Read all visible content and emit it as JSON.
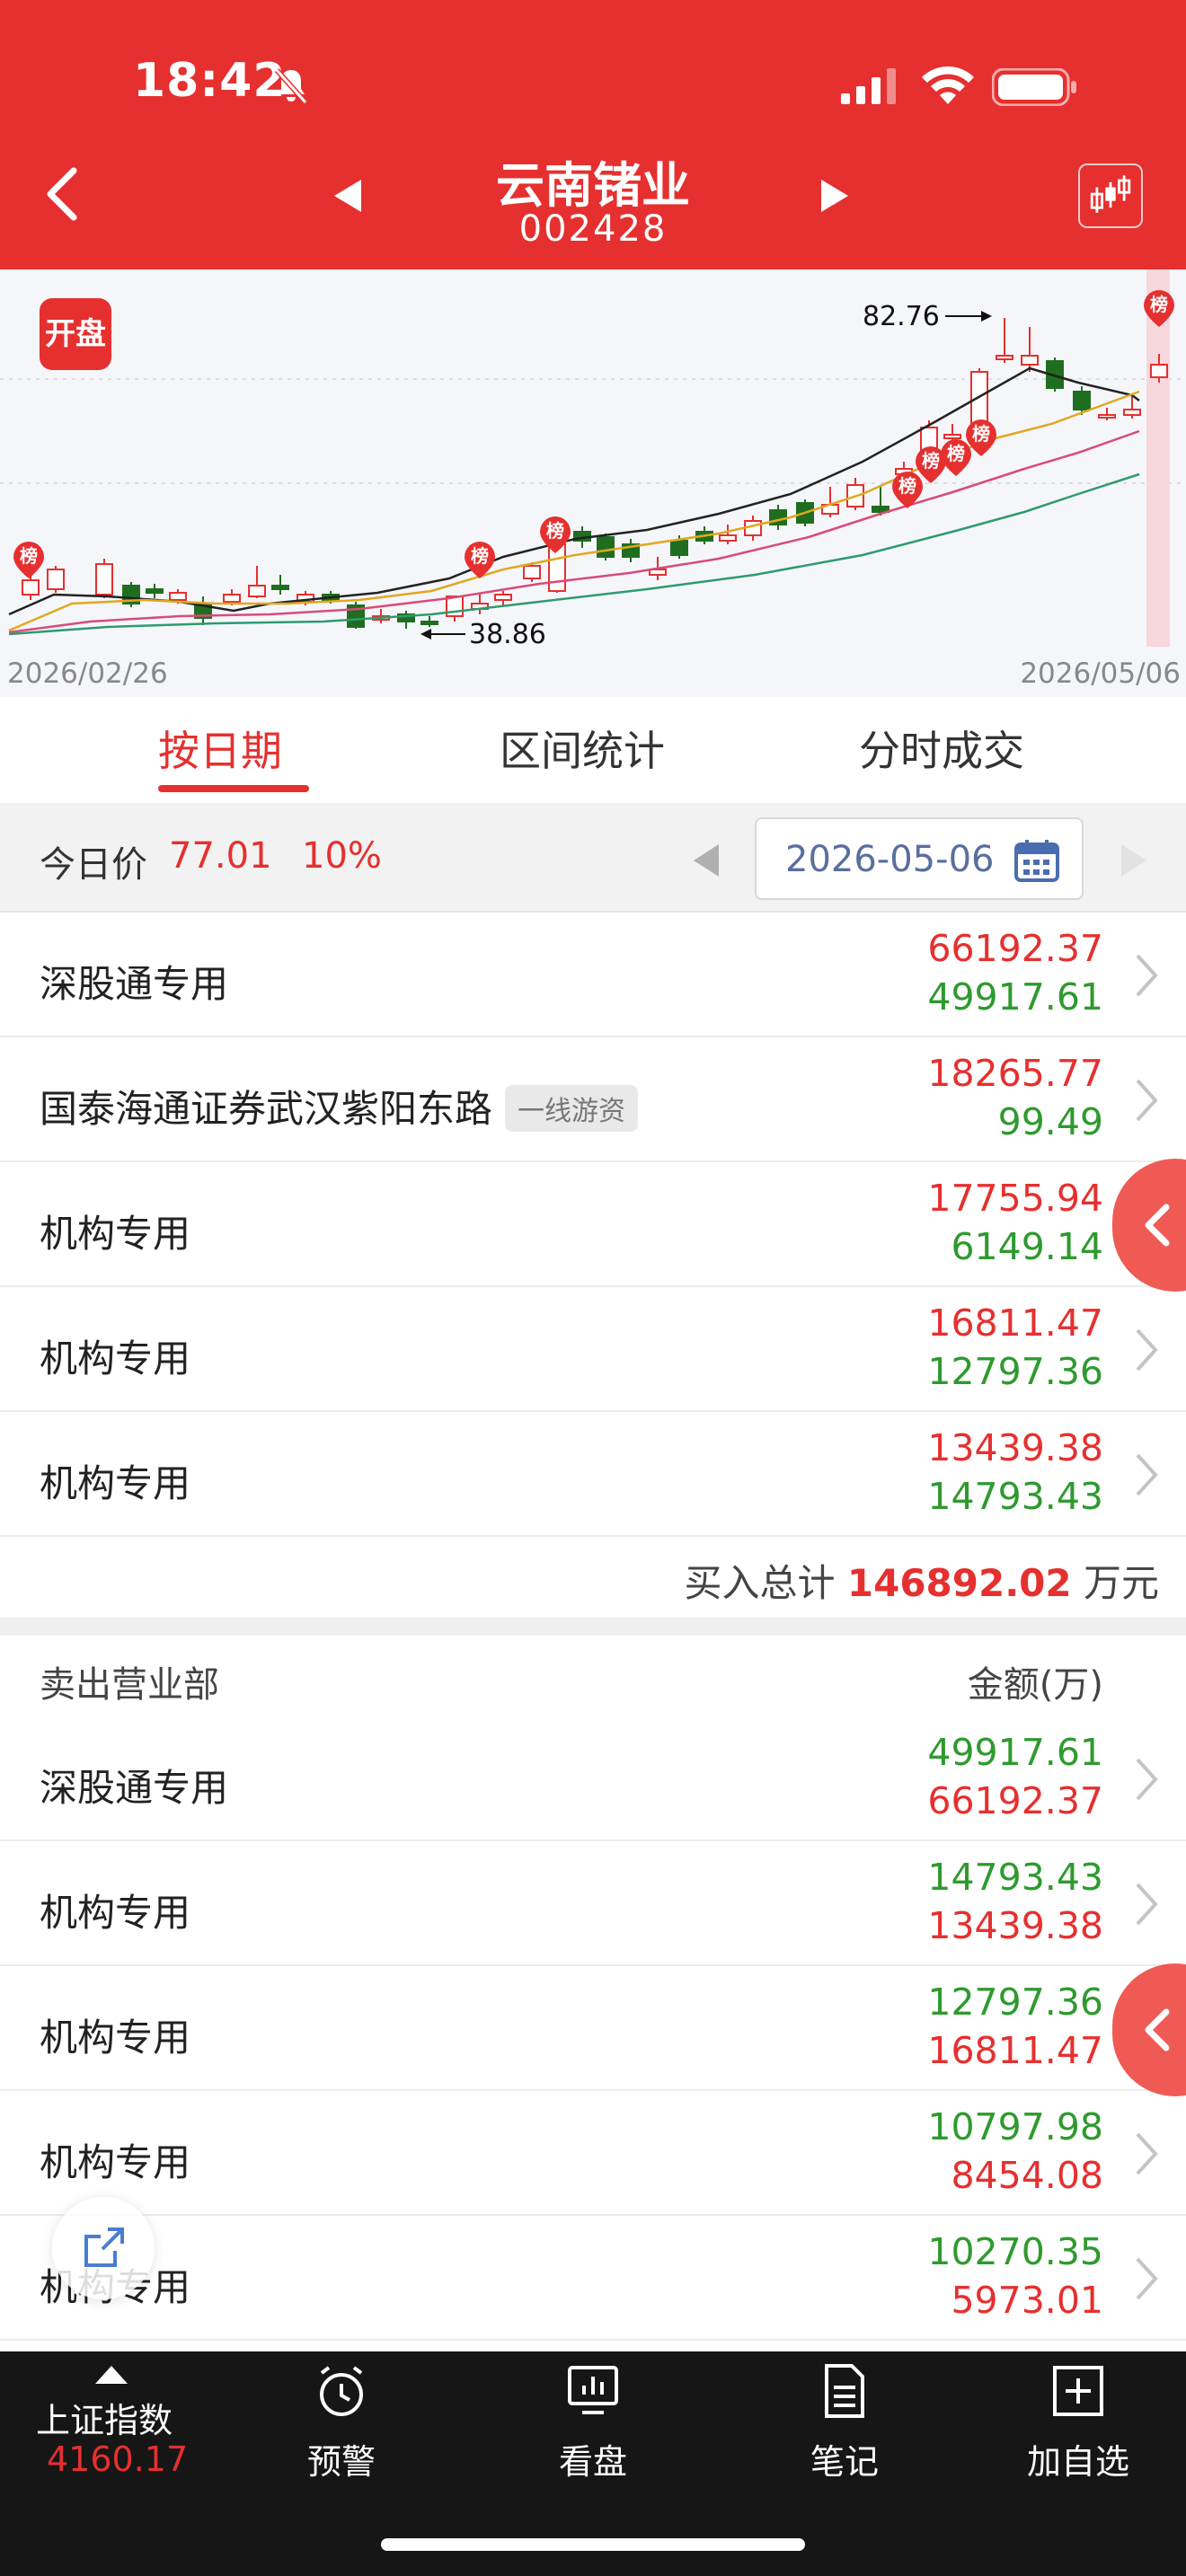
{
  "status_bar": {
    "time": "18:42"
  },
  "header": {
    "stock_name": "云南锗业",
    "stock_code": "002428"
  },
  "kline": {
    "badge": "开盘",
    "marker_label": "榜",
    "high_label": "82.76",
    "low_label": "38.86",
    "start_date": "2026/02/26",
    "end_date": "2026/05/06"
  },
  "tabs": [
    "按日期",
    "区间统计",
    "分时成交"
  ],
  "price_bar": {
    "label": "今日价",
    "price": "77.01",
    "change_pct": "10%",
    "date": "2026-05-06"
  },
  "buy_rows": [
    {
      "name": "深股通专用",
      "tag": "",
      "buy": "66192.37",
      "sell": "49917.61"
    },
    {
      "name": "国泰海通证券武汉紫阳东路",
      "tag": "一线游资",
      "buy": "18265.77",
      "sell": "99.49"
    },
    {
      "name": "机构专用",
      "tag": "",
      "buy": "17755.94",
      "sell": "6149.14"
    },
    {
      "name": "机构专用",
      "tag": "",
      "buy": "16811.47",
      "sell": "12797.36"
    },
    {
      "name": "机构专用",
      "tag": "",
      "buy": "13439.38",
      "sell": "14793.43"
    }
  ],
  "buy_total": {
    "label": "买入总计",
    "value": "146892.02",
    "unit": "万元"
  },
  "sell_section": {
    "title": "卖出营业部",
    "unit_label": "金额(万)"
  },
  "sell_rows": [
    {
      "name": "深股通专用",
      "sell": "49917.61",
      "buy": "66192.37"
    },
    {
      "name": "机构专用",
      "sell": "14793.43",
      "buy": "13439.38"
    },
    {
      "name": "机构专用",
      "sell": "12797.36",
      "buy": "16811.47"
    },
    {
      "name": "机构专用",
      "sell": "10797.98",
      "buy": "8454.08"
    },
    {
      "name": "机构专用",
      "sell": "10270.35",
      "buy": "5973.01"
    }
  ],
  "bottom_nav": {
    "index_name": "上证指数",
    "index_value": "4160.17",
    "items": [
      "预警",
      "看盘",
      "笔记",
      "加自选"
    ]
  },
  "colors": {
    "brand_red": "#e5302f",
    "up": "#e5302f",
    "down": "#2e9a2e"
  }
}
